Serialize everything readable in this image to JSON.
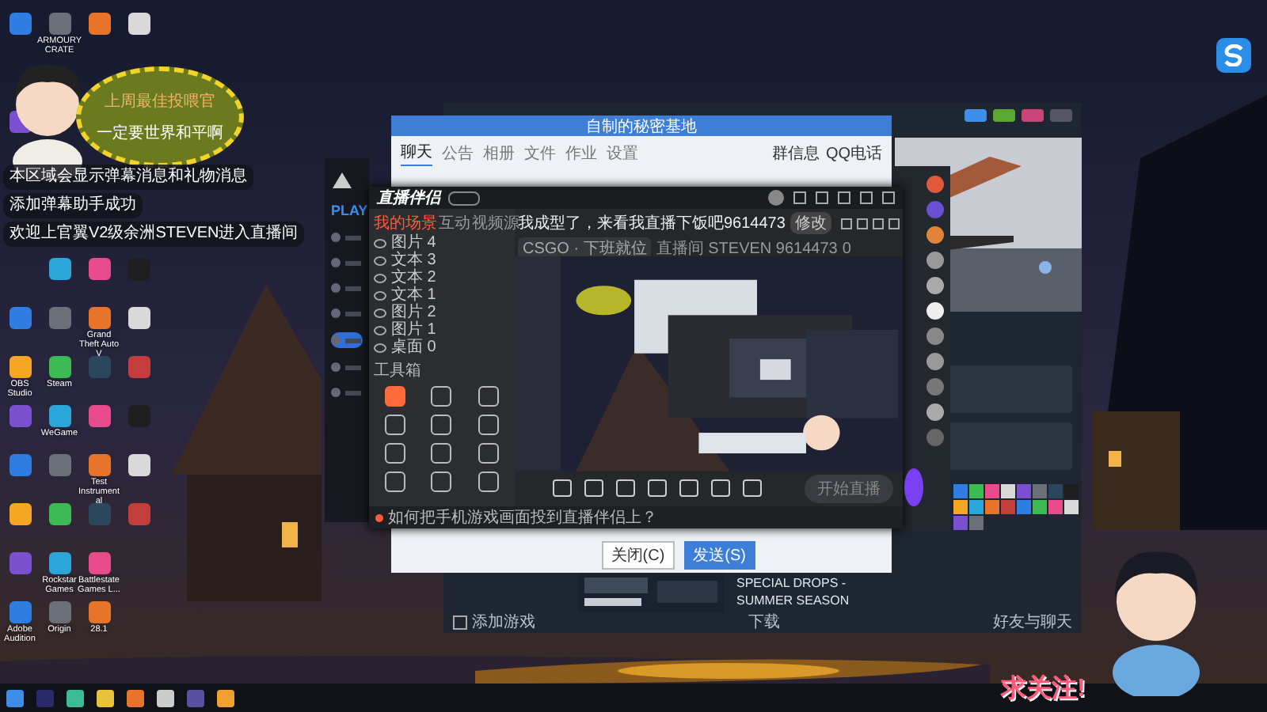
{
  "desktop": {
    "icon_rows": [
      [
        {
          "kind": "app"
        },
        {
          "kind": "app",
          "label": "ARMOURY CRATE"
        },
        {
          "kind": "app"
        },
        {
          "kind": "app"
        }
      ],
      [
        {
          "kind": "empty"
        },
        {
          "kind": "empty"
        },
        {
          "kind": "empty"
        },
        {
          "kind": "empty"
        }
      ],
      [
        {
          "kind": "app"
        },
        {
          "kind": "empty"
        },
        {
          "kind": "empty"
        },
        {
          "kind": "empty"
        }
      ],
      [
        {
          "kind": "empty"
        },
        {
          "kind": "empty"
        },
        {
          "kind": "empty"
        },
        {
          "kind": "empty"
        }
      ],
      [
        {
          "kind": "empty"
        },
        {
          "kind": "empty"
        },
        {
          "kind": "empty"
        },
        {
          "kind": "empty"
        }
      ],
      [
        {
          "kind": "empty"
        },
        {
          "kind": "app"
        },
        {
          "kind": "app"
        },
        {
          "kind": "app"
        }
      ],
      [
        {
          "kind": "app"
        },
        {
          "kind": "app"
        },
        {
          "kind": "app",
          "label": "Grand Theft Auto V"
        },
        {
          "kind": "app"
        }
      ],
      [
        {
          "kind": "app",
          "label": "OBS Studio"
        },
        {
          "kind": "app",
          "label": "Steam"
        },
        {
          "kind": "app"
        },
        {
          "kind": "app"
        }
      ],
      [
        {
          "kind": "app"
        },
        {
          "kind": "app",
          "label": "WeGame"
        },
        {
          "kind": "app"
        },
        {
          "kind": "app"
        }
      ],
      [
        {
          "kind": "app"
        },
        {
          "kind": "app"
        },
        {
          "kind": "app",
          "label": "Test Instrumental"
        },
        {
          "kind": "app"
        }
      ],
      [
        {
          "kind": "app"
        },
        {
          "kind": "app"
        },
        {
          "kind": "app"
        },
        {
          "kind": "app"
        }
      ],
      [
        {
          "kind": "app"
        },
        {
          "kind": "app",
          "label": "Rockstar Games"
        },
        {
          "kind": "app",
          "label": "Battlestate Games L..."
        },
        {
          "kind": "empty"
        }
      ],
      [
        {
          "kind": "app",
          "label": "Adobe Audition"
        },
        {
          "kind": "app",
          "label": "Origin"
        },
        {
          "kind": "app",
          "label": "28.1"
        },
        {
          "kind": "empty"
        }
      ]
    ]
  },
  "sticker": {
    "lines": [
      "上周最佳投喂官",
      "一定要世界和平啊"
    ]
  },
  "danmaku": {
    "messages": [
      {
        "text": "本区域会显示弹幕消息和礼物消息"
      },
      {
        "text": "添加弹幕助手成功"
      },
      {
        "text": "欢迎上官翼V2级余洲STEVEN进入直播间"
      }
    ]
  },
  "launcher": {
    "play": "PLAY",
    "nav": [
      {
        "selected": false
      },
      {
        "selected": false
      },
      {
        "selected": false
      },
      {
        "selected": false
      },
      {
        "selected": true
      },
      {
        "selected": false
      },
      {
        "selected": false
      }
    ]
  },
  "steam": {
    "news_title": "SPECIAL DROPS - SUMMER SEASON",
    "add_game": "添加游戏",
    "downloads": "下载",
    "friends_chat": "好友与聊天"
  },
  "qq": {
    "title": "自制的秘密基地",
    "tabs": [
      {
        "label": "聊天",
        "selected": true
      },
      {
        "label": "公告",
        "selected": false
      },
      {
        "label": "相册",
        "selected": false
      },
      {
        "label": "文件",
        "selected": false
      },
      {
        "label": "作业",
        "selected": false
      },
      {
        "label": "设置",
        "selected": false
      }
    ],
    "side_buttons": [
      "群信息",
      "QQ电话"
    ],
    "buttons": [
      "关闭(C)",
      "发送(S)"
    ]
  },
  "streamer": {
    "app_name": "直播伴侣",
    "scene_tabs": [
      {
        "label": "我的场景",
        "selected": true
      },
      {
        "label": "互动",
        "selected": false
      },
      {
        "label": "视频源",
        "selected": false
      }
    ],
    "sources": [
      "图片 4",
      "文本 3",
      "文本 2",
      "文本 1",
      "图片 2",
      "图片 1",
      "桌面 0"
    ],
    "toolbox_title": "工具箱",
    "room": {
      "title": "我成型了，来看我直播下饭吧9614473",
      "edit": "修改",
      "category": "CSGO · 下班就位",
      "info": "直播间 STEVEN 9614473",
      "viewers": "0"
    },
    "start_button": "开始直播",
    "tip": "如何把手机游戏画面投到直播伴侣上？"
  },
  "follow": {
    "text": "求关注!"
  }
}
